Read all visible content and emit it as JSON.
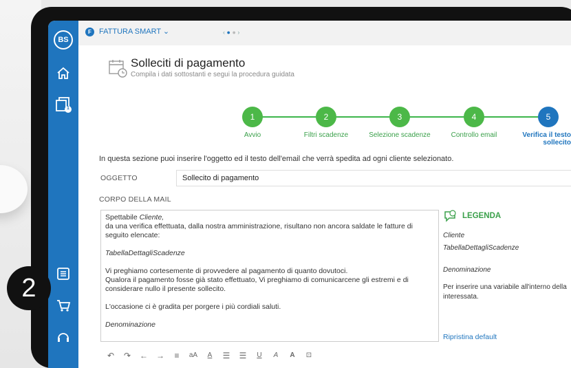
{
  "app": {
    "name": "FATTURA SMART",
    "avatar_initials": "BS",
    "app_icon_letter": "F",
    "notification_count": "1"
  },
  "dialog": {
    "title": "Solleciti di pagamento",
    "subtitle": "Compila i dati sottostanti e segui la procedura guidata"
  },
  "steps": [
    {
      "number": "1",
      "label": "Avvio"
    },
    {
      "number": "2",
      "label": "Filtri scadenze"
    },
    {
      "number": "3",
      "label": "Selezione scadenze"
    },
    {
      "number": "4",
      "label": "Controllo email"
    },
    {
      "number": "5",
      "label": "Verifica il testo sollecito"
    }
  ],
  "intro_text": "In questa sezione puoi inserire l'oggetto ed il testo dell'email che verrà spedita ad ogni cliente selezionato.",
  "subject": {
    "label": "OGGETTO",
    "value": "Sollecito di pagamento"
  },
  "body": {
    "label": "CORPO DELLA MAIL",
    "greeting_prefix": "Spettabile ",
    "greeting_var": "Cliente,",
    "line1": "da una verifica effettuata, dalla nostra amministrazione, risultano non ancora saldate le fatture di seguito elencate:",
    "table_var": "TabellaDettagliScadenze",
    "line2": "Vi preghiamo cortesemente di provvedere al pagamento di quanto dovutoci.",
    "line3": "Qualora il pagamento fosse già stato effettuato, Vi preghiamo di comunicarcene gli estremi e di considerare nullo il presente sollecito.",
    "line4": "L'occasione ci è gradita per porgere i più cordiali saluti.",
    "signature_var": "Denominazione"
  },
  "legend": {
    "title": "LEGENDA",
    "items": [
      "Cliente",
      "TabellaDettagliScadenze",
      "Denominazione"
    ],
    "note": "Per inserire una variabile all'interno della interessata."
  },
  "reset_label": "Ripristina default",
  "toolbar": [
    "↶",
    "↷",
    "←",
    "→",
    "≡",
    "aA",
    "A",
    "☰",
    "☰",
    "U",
    "A",
    "A",
    "⊡"
  ],
  "overlay_number": "2",
  "colors": {
    "primary": "#1f75be",
    "success": "#4cb848"
  }
}
